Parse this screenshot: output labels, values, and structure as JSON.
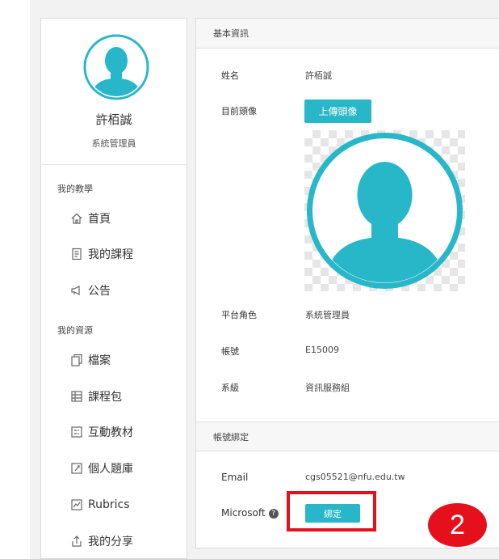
{
  "colors": {
    "accent": "#27b7c8",
    "highlight": "#e3111b"
  },
  "profile": {
    "name": "許栢誠",
    "role": "系統管理員",
    "avatar_icon": "user-avatar-icon"
  },
  "sidebar": {
    "sections": [
      {
        "label": "我的教學",
        "items": [
          {
            "label": "首頁",
            "icon": "home-icon"
          },
          {
            "label": "我的課程",
            "icon": "document-icon"
          },
          {
            "label": "公告",
            "icon": "megaphone-icon"
          }
        ]
      },
      {
        "label": "我的資源",
        "items": [
          {
            "label": "檔案",
            "icon": "files-icon"
          },
          {
            "label": "課程包",
            "icon": "package-icon"
          },
          {
            "label": "互動教材",
            "icon": "interactive-icon"
          },
          {
            "label": "個人題庫",
            "icon": "question-bank-icon"
          },
          {
            "label": "Rubrics",
            "icon": "rubrics-icon"
          },
          {
            "label": "我的分享",
            "icon": "share-icon"
          }
        ]
      }
    ]
  },
  "basic_info": {
    "header": "基本資訊",
    "name_label": "姓名",
    "name_value": "許栢誠",
    "avatar_label": "目前頭像",
    "upload_button": "上傳頭像",
    "role_label": "平台角色",
    "role_value": "系統管理員",
    "account_label": "帳號",
    "account_value": "E15009",
    "dept_label": "系級",
    "dept_value": "資訊服務組"
  },
  "binding": {
    "header": "帳號綁定",
    "email_label": "Email",
    "email_value": "cgs05521@nfu.edu.tw",
    "microsoft_label": "Microsoft",
    "help_glyph": "?",
    "bind_button": "綁定"
  },
  "annotation": {
    "step_number": "2"
  }
}
